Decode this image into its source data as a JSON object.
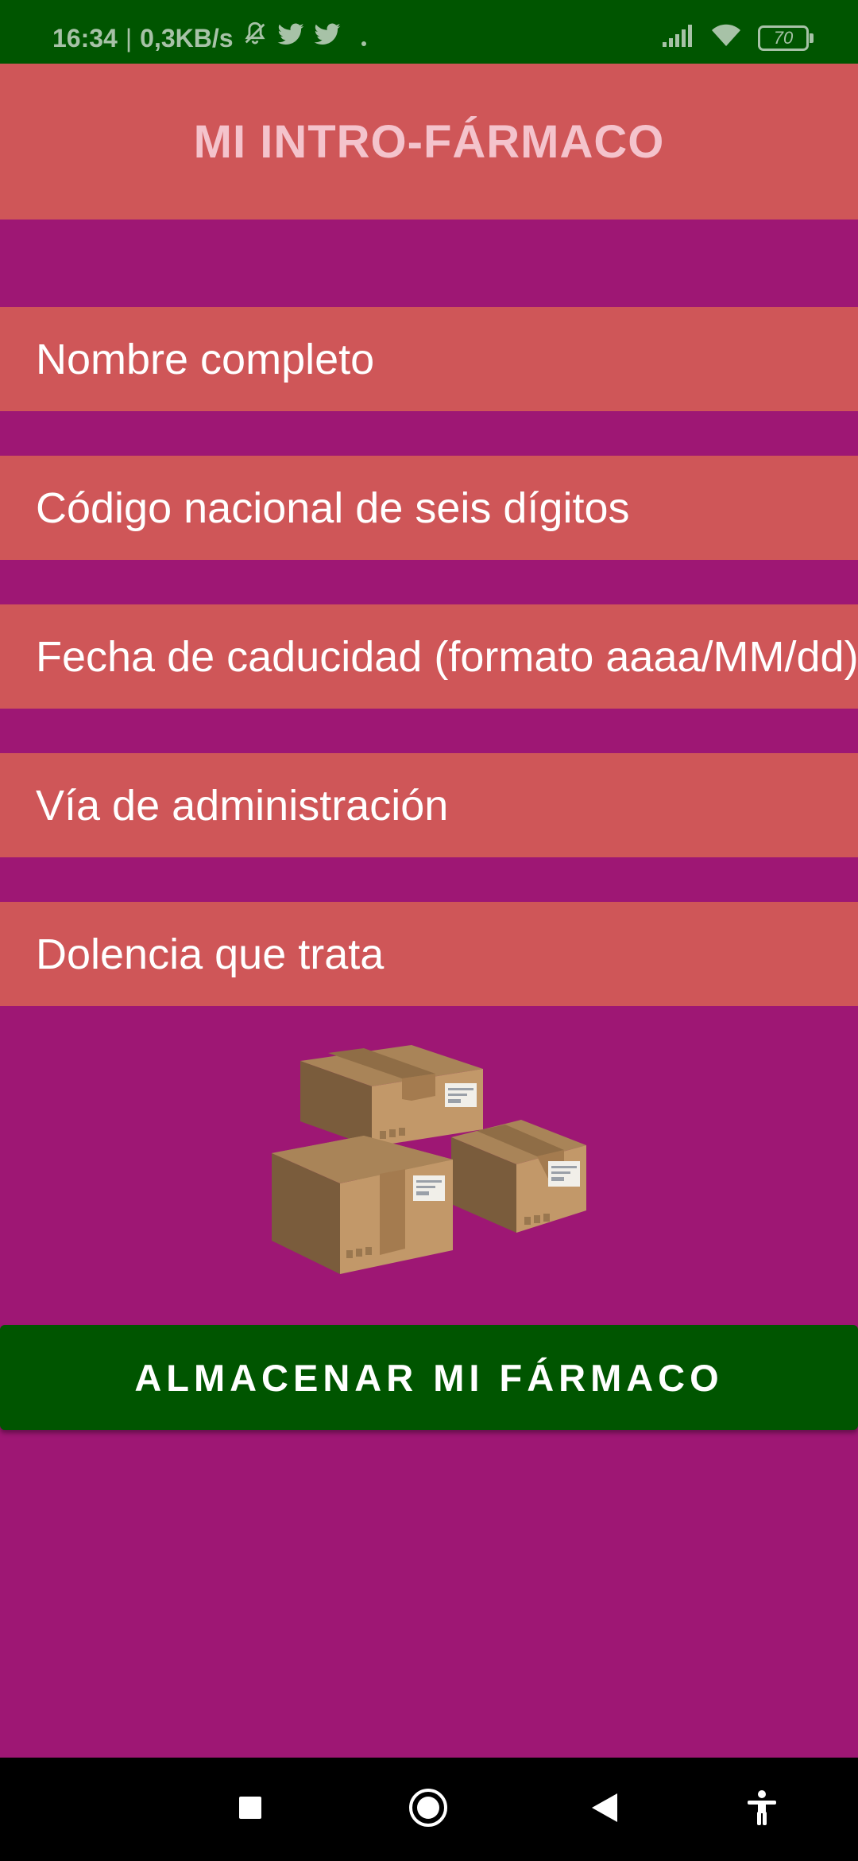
{
  "status_bar": {
    "time": "16:34",
    "separator": "|",
    "network_speed": "0,3KB/s",
    "notification_icons": [
      "mute-bell-icon",
      "twitter-icon",
      "twitter-icon",
      "dot-icon"
    ],
    "battery_level": "70"
  },
  "header": {
    "title": "MI INTRO-FÁRMACO"
  },
  "form": {
    "fields": [
      {
        "placeholder": "Nombre completo"
      },
      {
        "placeholder": "Código nacional de seis dígitos"
      },
      {
        "placeholder": "Fecha de caducidad (formato aaaa/MM/dd)"
      },
      {
        "placeholder": "Vía de administración"
      },
      {
        "placeholder": "Dolencia que trata"
      }
    ]
  },
  "illustration": {
    "icon": "cardboard-boxes-icon"
  },
  "actions": {
    "store_label": "ALMACENAR MI FÁRMACO"
  },
  "nav_bar": {
    "icons": [
      "recents-square-icon",
      "home-circle-icon",
      "back-triangle-icon",
      "accessibility-icon"
    ]
  },
  "colors": {
    "status_bar": "#005500",
    "background": "#9e1774",
    "field_background": "#cf5658",
    "title_text": "#f4c3cc",
    "button_background": "#005500",
    "nav_bar": "#000000"
  }
}
